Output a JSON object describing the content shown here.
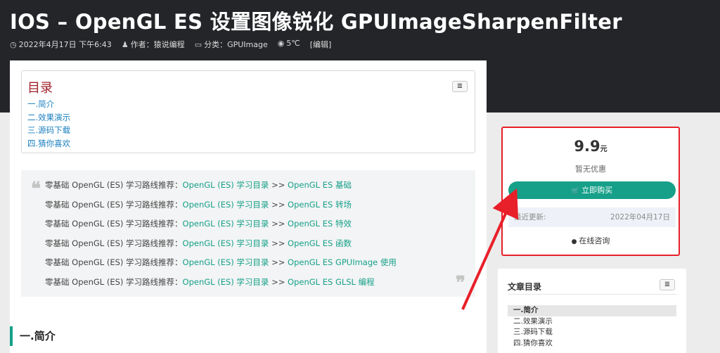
{
  "header": {
    "title": "IOS  –  OpenGL ES 设置图像锐化 GPUImageSharpenFilter",
    "meta": {
      "date": "2022年4月17日 下午6:43",
      "author": "作者：猿说编程",
      "category": "分类：GPUImage",
      "views": "5℃",
      "edit": "[编辑]"
    },
    "icons": {
      "clock": "◷",
      "user": "♟",
      "folder": "▭",
      "eye": "◉"
    }
  },
  "toc": {
    "title": "目录",
    "toggle_icon": "≣",
    "items": [
      "一.简介",
      "二.效果演示",
      "三.源码下载",
      "四.猜你喜欢"
    ]
  },
  "quote": {
    "prefix": "零基础 OpenGL (ES) 学习路线推荐：",
    "link1": "OpenGL (ES) 学习目录",
    "sep": " >> ",
    "lines": [
      "OpenGL ES 基础",
      "OpenGL ES 转场",
      "OpenGL ES 特效",
      "OpenGL ES 函数",
      "OpenGL ES GPUImage 使用",
      "OpenGL ES GLSL 编程"
    ],
    "open_mark": "❝",
    "close_mark": "❞"
  },
  "section": {
    "heading": "一.简介"
  },
  "buy": {
    "price": "9.9",
    "unit": "元",
    "discount": "暂无优惠",
    "button": "立即购买",
    "cart_icon": "🛒",
    "update_label": "最近更新:",
    "update_date": "2022年04月17日",
    "consult": "在线咨询",
    "qq_icon": "●"
  },
  "side_toc": {
    "title": "文章目录",
    "toggle_icon": "≣",
    "items": [
      "一.简介",
      "二.效果演示",
      "三.源码下载",
      "四.猜你喜欢"
    ]
  },
  "colors": {
    "accent": "#16a089",
    "header_bg": "#232528",
    "highlight": "#e8202a",
    "toc_title": "#a0222a"
  }
}
